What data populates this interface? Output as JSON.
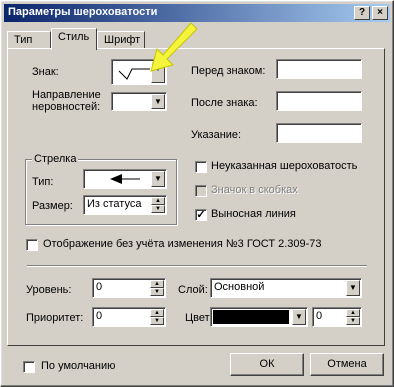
{
  "window": {
    "title": "Параметры шероховатости",
    "help_label": "?",
    "close_label": "×"
  },
  "tabs": [
    "Тип",
    "Стиль",
    "Шрифт"
  ],
  "style": {
    "sign_label": "Знак:",
    "direction_label": "Направление неровностей:",
    "before_sign_label": "Перед знаком:",
    "after_sign_label": "После знака:",
    "indication_label": "Указание:",
    "arrow_group": "Стрелка",
    "arrow_type_label": "Тип:",
    "arrow_size_label": "Размер:",
    "arrow_size_value": "Из статуса",
    "cb_unspecified": "Неуказанная шероховатость",
    "cb_brackets": "Значок в скобках",
    "cb_leader": "Выносная линия",
    "cb_gost": "Отображение без учёта изменения №3 ГОСТ 2.309-73",
    "level_label": "Уровень:",
    "level_value": "0",
    "priority_label": "Приоритет:",
    "priority_value": "0",
    "layer_label": "Слой:",
    "layer_value": "Основной",
    "color_label": "Цвет:",
    "color_value": "0",
    "color_swatch": "#000000"
  },
  "footer": {
    "default_label": "По умолчанию",
    "ok_label": "ОК",
    "cancel_label": "Отмена"
  },
  "checks": {
    "unspecified": false,
    "brackets": false,
    "leader": true,
    "gost": false,
    "default": false
  }
}
